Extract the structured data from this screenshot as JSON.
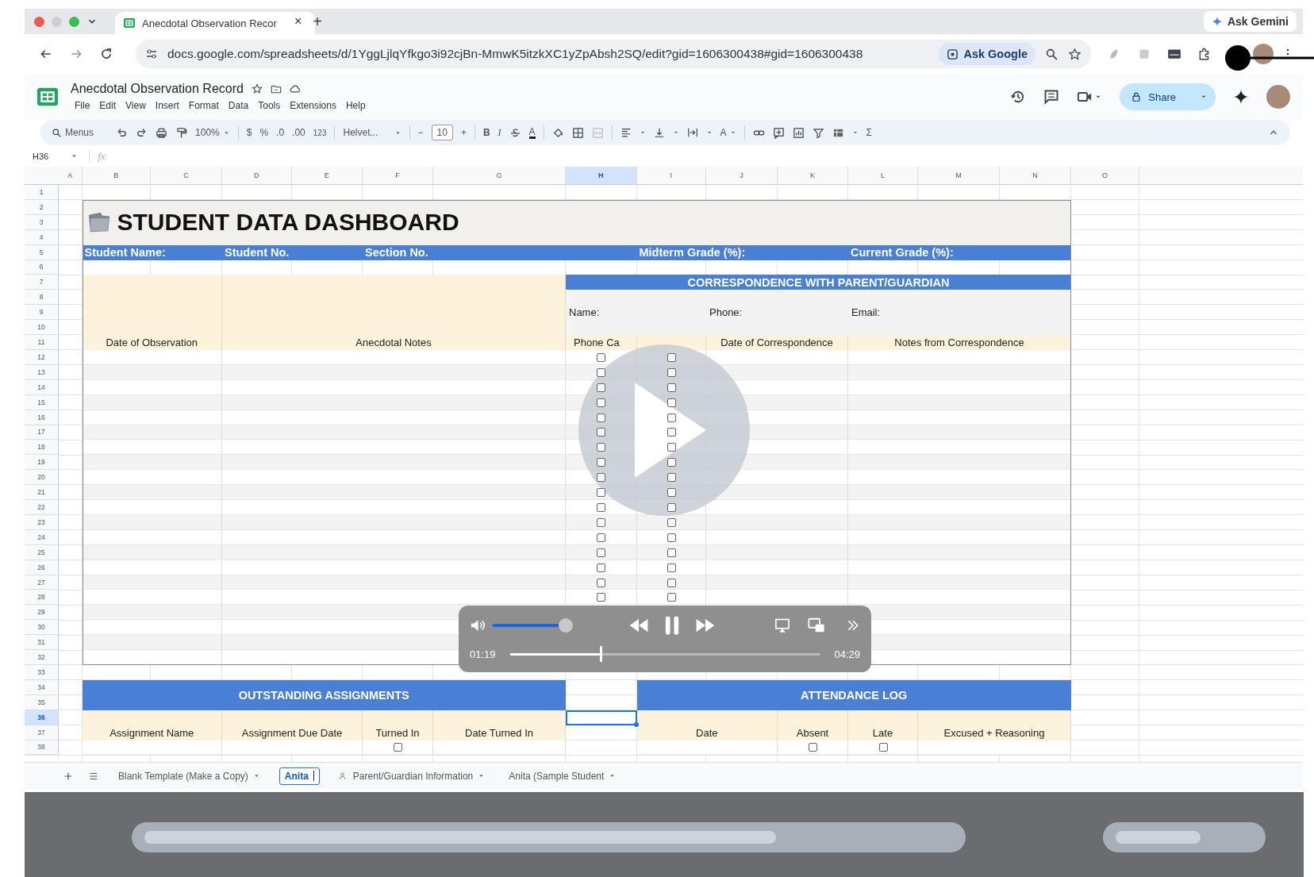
{
  "browser": {
    "tab": {
      "title": "Anecdotal Observation Recor",
      "close": "×"
    },
    "new_tab": "+",
    "ask_gemini": "Ask Gemini",
    "url": "docs.google.com/spreadsheets/d/1YggLjlqYfkgo3i92cjBn-MmwK5itzkXC1yZpAbsh2SQ/edit?gid=1606300438#gid=1606300438",
    "ask_google": "Ask Google"
  },
  "document": {
    "title": "Anecdotal Observation Record",
    "menu": [
      "File",
      "Edit",
      "View",
      "Insert",
      "Format",
      "Data",
      "Tools",
      "Extensions",
      "Help"
    ],
    "share": "Share"
  },
  "toolbar": {
    "search": "Menus",
    "zoom": "100%",
    "currency": "$",
    "percent": "%",
    "decrease_decimals": ".0",
    "increase_decimals": ".00",
    "number_format": "123",
    "font": "Helvet...",
    "font_size_decrease": "−",
    "font_size": "10",
    "font_size_increase": "+",
    "bold": "B",
    "italic": "I",
    "text_color": "A",
    "rotate_text": "A",
    "functions": "Σ"
  },
  "formula_bar": {
    "cell": "H36",
    "fx": "fx"
  },
  "columns": [
    {
      "label": "A",
      "selected": false
    },
    {
      "label": "B",
      "selected": false
    },
    {
      "label": "C",
      "selected": false
    },
    {
      "label": "D",
      "selected": false
    },
    {
      "label": "E",
      "selected": false
    },
    {
      "label": "F",
      "selected": false
    },
    {
      "label": "G",
      "selected": false
    },
    {
      "label": "H",
      "selected": true
    },
    {
      "label": "I",
      "selected": false
    },
    {
      "label": "J",
      "selected": false
    },
    {
      "label": "K",
      "selected": false
    },
    {
      "label": "L",
      "selected": false
    },
    {
      "label": "M",
      "selected": false
    },
    {
      "label": "N",
      "selected": false
    },
    {
      "label": "O",
      "selected": false
    }
  ],
  "rows": [
    {
      "label": "1",
      "selected": false
    },
    {
      "label": "2",
      "selected": false
    },
    {
      "label": "3",
      "selected": false
    },
    {
      "label": "4",
      "selected": false
    },
    {
      "label": "5",
      "selected": false
    },
    {
      "label": "6",
      "selected": false
    },
    {
      "label": "7",
      "selected": false
    },
    {
      "label": "8",
      "selected": false
    },
    {
      "label": "9",
      "selected": false
    },
    {
      "label": "10",
      "selected": false
    },
    {
      "label": "11",
      "selected": false
    },
    {
      "label": "12",
      "selected": false
    },
    {
      "label": "13",
      "selected": false
    },
    {
      "label": "14",
      "selected": false
    },
    {
      "label": "15",
      "selected": false
    },
    {
      "label": "16",
      "selected": false
    },
    {
      "label": "17",
      "selected": false
    },
    {
      "label": "18",
      "selected": false
    },
    {
      "label": "19",
      "selected": false
    },
    {
      "label": "20",
      "selected": false
    },
    {
      "label": "21",
      "selected": false
    },
    {
      "label": "22",
      "selected": false
    },
    {
      "label": "23",
      "selected": false
    },
    {
      "label": "24",
      "selected": false
    },
    {
      "label": "25",
      "selected": false
    },
    {
      "label": "26",
      "selected": false
    },
    {
      "label": "27",
      "selected": false
    },
    {
      "label": "28",
      "selected": false
    },
    {
      "label": "29",
      "selected": false
    },
    {
      "label": "30",
      "selected": false
    },
    {
      "label": "31",
      "selected": false
    },
    {
      "label": "32",
      "selected": false
    },
    {
      "label": "33",
      "selected": false
    },
    {
      "label": "34",
      "selected": false
    },
    {
      "label": "35",
      "selected": false
    },
    {
      "label": "36",
      "selected": true
    },
    {
      "label": "37",
      "selected": false
    },
    {
      "label": "38",
      "selected": false
    }
  ],
  "dashboard": {
    "title": "STUDENT DATA DASHBOARD",
    "info_fields": [
      "Student Name:",
      "Student No.",
      "Section No.",
      "Midterm Grade (%):",
      "Current Grade (%):"
    ],
    "observation_headers": [
      "Date of Observation",
      "Anecdotal Notes"
    ],
    "correspondence": {
      "title": "CORRESPONDENCE WITH PARENT/GUARDIAN",
      "contact_fields": [
        "Name:",
        "Phone:",
        "Email:"
      ],
      "columns": [
        "Phone Ca",
        "Date of Correspondence",
        "Notes from Correspondence"
      ]
    },
    "observation_rows": [
      {
        "kind": "checkbox",
        "phone_call_checked": false,
        "column_9_checked": false
      },
      {
        "kind": "checkbox",
        "phone_call_checked": false,
        "column_9_checked": false
      },
      {
        "kind": "checkbox",
        "phone_call_checked": false,
        "column_9_checked": false
      },
      {
        "kind": "checkbox",
        "phone_call_checked": false,
        "column_9_checked": false
      },
      {
        "kind": "checkbox",
        "phone_call_checked": false,
        "column_9_checked": false
      },
      {
        "kind": "checkbox",
        "phone_call_checked": false,
        "column_9_checked": false
      },
      {
        "kind": "checkbox",
        "phone_call_checked": false,
        "column_9_checked": false
      },
      {
        "kind": "checkbox",
        "phone_call_checked": false,
        "column_9_checked": false
      },
      {
        "kind": "checkbox",
        "phone_call_checked": false,
        "column_9_checked": false
      },
      {
        "kind": "checkbox",
        "phone_call_checked": false,
        "column_9_checked": false
      },
      {
        "kind": "checkbox",
        "phone_call_checked": false,
        "column_9_checked": false
      },
      {
        "kind": "checkbox",
        "phone_call_checked": false,
        "column_9_checked": false
      },
      {
        "kind": "checkbox",
        "phone_call_checked": false,
        "column_9_checked": false
      },
      {
        "kind": "checkbox",
        "phone_call_checked": false,
        "column_9_checked": false
      },
      {
        "kind": "checkbox",
        "phone_call_checked": false,
        "column_9_checked": false
      },
      {
        "kind": "checkbox",
        "phone_call_checked": false,
        "column_9_checked": false
      },
      {
        "kind": "checkbox",
        "phone_call_checked": false,
        "column_9_checked": false
      },
      {
        "kind": "blank"
      },
      {
        "kind": "blank"
      },
      {
        "kind": "blank"
      },
      {
        "kind": "blank"
      }
    ]
  },
  "assignments": {
    "title": "OUTSTANDING ASSIGNMENTS",
    "columns": [
      "Assignment Name",
      "Assignment Due Date",
      "Turned In",
      "Date Turned In"
    ],
    "rows": [
      {
        "turned_in_checked": false
      }
    ]
  },
  "attendance": {
    "title": "ATTENDANCE LOG",
    "columns": [
      "Date",
      "Absent",
      "Late",
      "Excused + Reasoning"
    ],
    "rows": [
      {
        "absent_checked": false,
        "late_checked": false
      }
    ]
  },
  "sheet_tabs": [
    {
      "label": "Blank Template (Make a Copy)",
      "selected": false,
      "kind": "normal"
    },
    {
      "label": "Anita",
      "selected": true,
      "kind": "editing"
    },
    {
      "label": "Parent/Guardian Information",
      "selected": false,
      "kind": "linked"
    },
    {
      "label": "Anita (Sample Student",
      "selected": false,
      "kind": "normal"
    }
  ],
  "video": {
    "playing": true,
    "volume": {
      "level": 1
    },
    "progress": {
      "level": 0.294
    },
    "elapsed": "01:19",
    "duration": "04:29"
  }
}
